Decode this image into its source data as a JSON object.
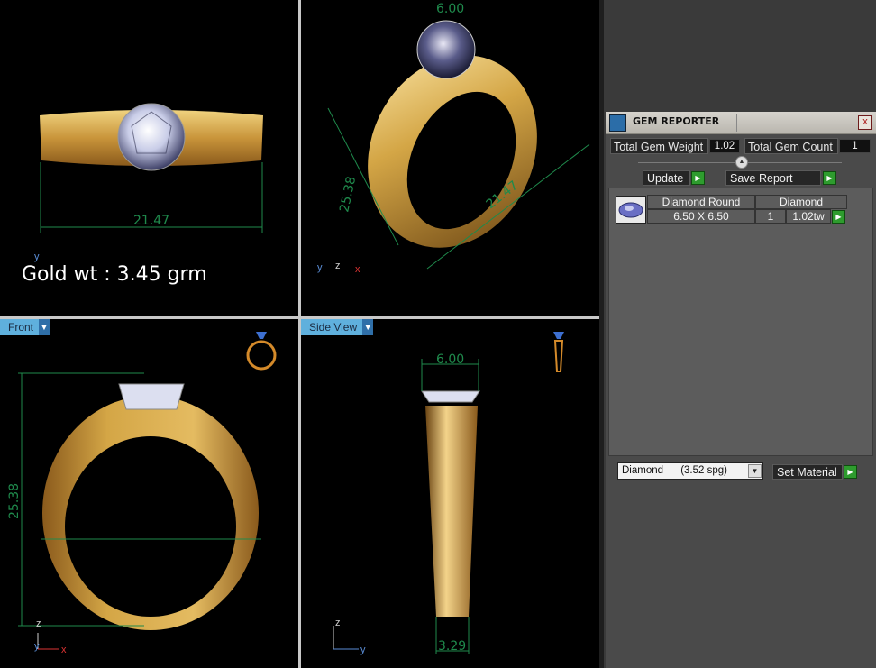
{
  "viewports": {
    "top_left": {
      "dimension": "21.47",
      "axis_y": "y",
      "note": "Gold wt : 3.45 grm"
    },
    "top_right": {
      "dimension_a": "21.47",
      "dimension_b": "25.38",
      "dimension_c": "6.00",
      "axis_x": "x",
      "axis_y": "y",
      "axis_z": "z"
    },
    "bottom_left": {
      "tab_label": "Front",
      "dimension": "25.38",
      "axis_x": "x",
      "axis_y": "y",
      "axis_z": "z"
    },
    "bottom_right": {
      "tab_label": "Side View",
      "dimension_top": "6.00",
      "dimension_bottom": "3.29",
      "axis_y": "y",
      "axis_z": "z"
    }
  },
  "gem_reporter": {
    "title": "GEM REPORTER",
    "close_glyph": "x",
    "total_gem_weight_label": "Total Gem Weight",
    "total_gem_weight_value": "1.02",
    "total_gem_count_label": "Total Gem Count",
    "total_gem_count_value": "1",
    "update_label": "Update",
    "save_report_label": "Save Report",
    "gems": [
      {
        "name": "Diamond Round",
        "material": "Diamond",
        "size": "6.50 X 6.50",
        "count": "1",
        "weight": "1.02tw"
      }
    ],
    "material_select": "Diamond      (3.52 spg)",
    "set_material_label": "Set Material"
  },
  "colors": {
    "gold": "#d4a646",
    "dimension_green": "#1f8a4c",
    "tab_blue": "#5fb0dd",
    "go_green": "#2e9c2e"
  }
}
